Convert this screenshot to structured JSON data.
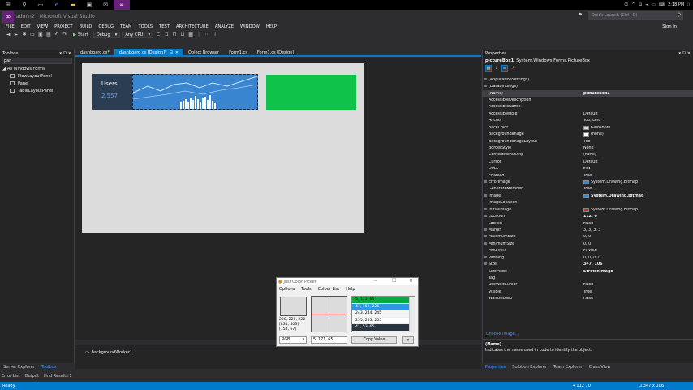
{
  "taskbar": {
    "time": "2:18 PM",
    "date": "",
    "icons": [
      "windows-logo",
      "search",
      "task-view",
      "edge",
      "file-explorer",
      "store",
      "mail",
      "visual-studio"
    ]
  },
  "window": {
    "title": "admin2 - Microsoft Visual Studio",
    "quick_launch_placeholder": "Quick Launch (Ctrl+Q)",
    "sign_in": "Sign in"
  },
  "menu": [
    "FILE",
    "EDIT",
    "VIEW",
    "PROJECT",
    "BUILD",
    "DEBUG",
    "TEAM",
    "TOOLS",
    "TEST",
    "ARCHITECTURE",
    "ANALYZE",
    "WINDOW",
    "HELP"
  ],
  "toolbar": {
    "start_label": "Start",
    "configuration": "Debug",
    "platform": "Any CPU"
  },
  "toolbox": {
    "title": "Toolbox",
    "search_value": "pan",
    "root": "All Windows Forms",
    "items": [
      "FlowLayoutPanel",
      "Panel",
      "TableLayoutPanel"
    ]
  },
  "tabs": [
    {
      "label": "dashboard.cs*",
      "active": false
    },
    {
      "label": "dashboard.cs [Design]*",
      "active": true
    },
    {
      "label": "Object Browser",
      "active": false
    },
    {
      "label": "Form1.cs",
      "active": false
    },
    {
      "label": "Form1.cs [Design]",
      "active": false
    }
  ],
  "designer": {
    "users_label": "Users",
    "users_value": "2,557",
    "tray_component": "backgroundWorker1",
    "colors": {
      "form": "#dcdcdc",
      "card": "#2b3d52",
      "chart": "#3a85d0",
      "green": "#0fc24a"
    }
  },
  "color_picker": {
    "title": "Just Color Picker",
    "menu": [
      "Options",
      "Tools",
      "Colour List",
      "Help"
    ],
    "values": [
      "220, 220, 220",
      "[831, 403]",
      "[154, 67]"
    ],
    "list": [
      {
        "text": "5, 171, 65",
        "bg": "#05ab41",
        "fg": "#000000"
      },
      {
        "text": "47, 152, 226",
        "bg": "#2f98e2",
        "fg": "#ffffff"
      },
      {
        "text": "243, 244, 245",
        "bg": "#f3f4f5",
        "fg": "#000000"
      },
      {
        "text": "255, 255, 255",
        "bg": "#ffffff",
        "fg": "#000000"
      },
      {
        "text": "41, 53, 65",
        "bg": "#293541",
        "fg": "#ffffff"
      }
    ],
    "mode": "RGB",
    "hex_value": "5, 171, 65",
    "copy_label": "Copy Value"
  },
  "properties": {
    "title": "Properties",
    "object_name": "pictureBox1",
    "object_type": "System.Windows.Forms.PictureBox",
    "rows": [
      {
        "name": "(ApplicationSettings)",
        "value": "",
        "exp": "⊞"
      },
      {
        "name": "(DataBindings)",
        "value": "",
        "exp": "⊞"
      },
      {
        "name": "(Name)",
        "value": "pictureBox1",
        "bold": true,
        "sel": true
      },
      {
        "name": "AccessibleDescription",
        "value": ""
      },
      {
        "name": "AccessibleName",
        "value": ""
      },
      {
        "name": "AccessibleRole",
        "value": "Default"
      },
      {
        "name": "Anchor",
        "value": "Top, Left"
      },
      {
        "name": "BackColor",
        "value": "Gainsboro",
        "swatch": "#dcdcdc"
      },
      {
        "name": "BackgroundImage",
        "value": "(none)",
        "swatch": "#ffffff"
      },
      {
        "name": "BackgroundImageLayout",
        "value": "Tile"
      },
      {
        "name": "BorderStyle",
        "value": "None"
      },
      {
        "name": "ContextMenuStrip",
        "value": "(none)"
      },
      {
        "name": "Cursor",
        "value": "Default"
      },
      {
        "name": "Dock",
        "value": "Fill",
        "bold": true
      },
      {
        "name": "Enabled",
        "value": "True"
      },
      {
        "name": "ErrorImage",
        "value": "System.Drawing.Bitmap",
        "exp": "⊞",
        "swatch": "#3a85d0"
      },
      {
        "name": "GenerateMember",
        "value": "True"
      },
      {
        "name": "Image",
        "value": "System.Drawing.Bitmap",
        "exp": "⊞",
        "bold": true,
        "swatch": "#3a85d0"
      },
      {
        "name": "ImageLocation",
        "value": ""
      },
      {
        "name": "InitialImage",
        "value": "System.Drawing.Bitmap",
        "exp": "⊞",
        "swatch": "#c03030"
      },
      {
        "name": "Location",
        "value": "112, 0",
        "exp": "⊞",
        "bold": true
      },
      {
        "name": "Locked",
        "value": "False"
      },
      {
        "name": "Margin",
        "value": "3, 3, 3, 3",
        "exp": "⊞"
      },
      {
        "name": "MaximumSize",
        "value": "0, 0",
        "exp": "⊞"
      },
      {
        "name": "MinimumSize",
        "value": "0, 0",
        "exp": "⊞"
      },
      {
        "name": "Modifiers",
        "value": "Private"
      },
      {
        "name": "Padding",
        "value": "0, 0, 0, 0",
        "exp": "⊞"
      },
      {
        "name": "Size",
        "value": "347, 106",
        "exp": "⊞",
        "bold": true
      },
      {
        "name": "SizeMode",
        "value": "StretchImage",
        "bold": true
      },
      {
        "name": "Tag",
        "value": ""
      },
      {
        "name": "UseWaitCursor",
        "value": "False"
      },
      {
        "name": "Visible",
        "value": "True"
      },
      {
        "name": "WaitOnLoad",
        "value": "False"
      }
    ],
    "choose_image": "Choose Image...",
    "desc_title": "(Name)",
    "desc_text": "Indicates the name used in code to identify the object."
  },
  "bottom_tabs_left": [
    {
      "label": "Server Explorer",
      "active": false
    },
    {
      "label": "Toolbox",
      "active": true
    }
  ],
  "bottom_tabs_right": [
    {
      "label": "Properties",
      "active": true
    },
    {
      "label": "Solution Explorer",
      "active": false
    },
    {
      "label": "Team Explorer",
      "active": false
    },
    {
      "label": "Class View",
      "active": false
    }
  ],
  "output_tabs": [
    "Error List",
    "Output",
    "Find Results 1"
  ],
  "status": {
    "text": "Ready",
    "position": "112 , 0",
    "size": "347 x 106"
  }
}
